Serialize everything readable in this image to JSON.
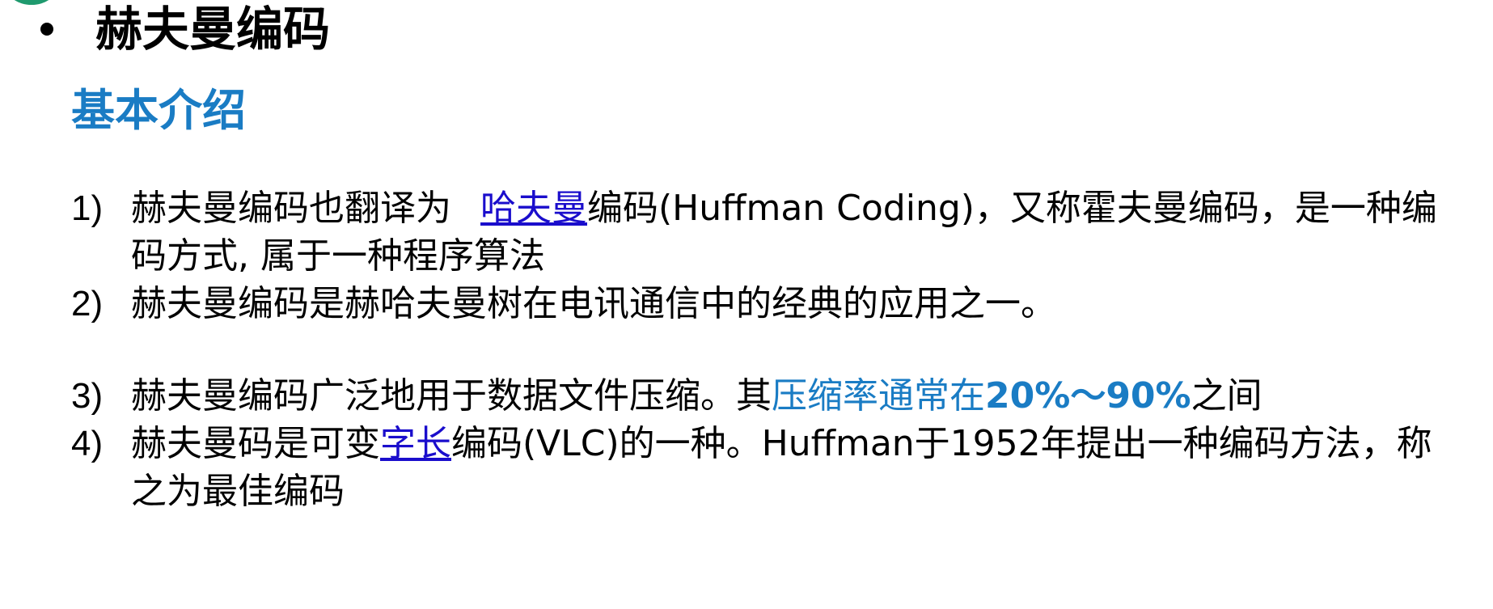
{
  "heading": {
    "title": "赫夫曼编码"
  },
  "section": {
    "title": "基本介绍"
  },
  "items": [
    {
      "num": "1)",
      "before": "赫夫曼编码也翻译为 ",
      "link": "哈夫曼",
      "after": "编码(Huffman Coding)，又称霍夫曼编码，是一种编码方式, 属于一种程序算法"
    },
    {
      "num": "2)",
      "text": "赫夫曼编码是赫哈夫曼树在电讯通信中的经典的应用之一。"
    },
    {
      "num": "3)",
      "before": "赫夫曼编码广泛地用于数据文件压缩。其",
      "highlight": "压缩率通常在",
      "highlight_bold": "20%～90%",
      "after": "之间"
    },
    {
      "num": "4)",
      "before": "赫夫曼码是可变",
      "link": "字长",
      "after": "编码(VLC)的一种。Huffman于1952年提出一种编码方法，称之为最佳编码"
    }
  ],
  "colors": {
    "section_title": "#1a7cc4",
    "link": "#1a0dcc",
    "highlight": "#1a7cc4",
    "corner_mark": "#1f9a6e"
  }
}
